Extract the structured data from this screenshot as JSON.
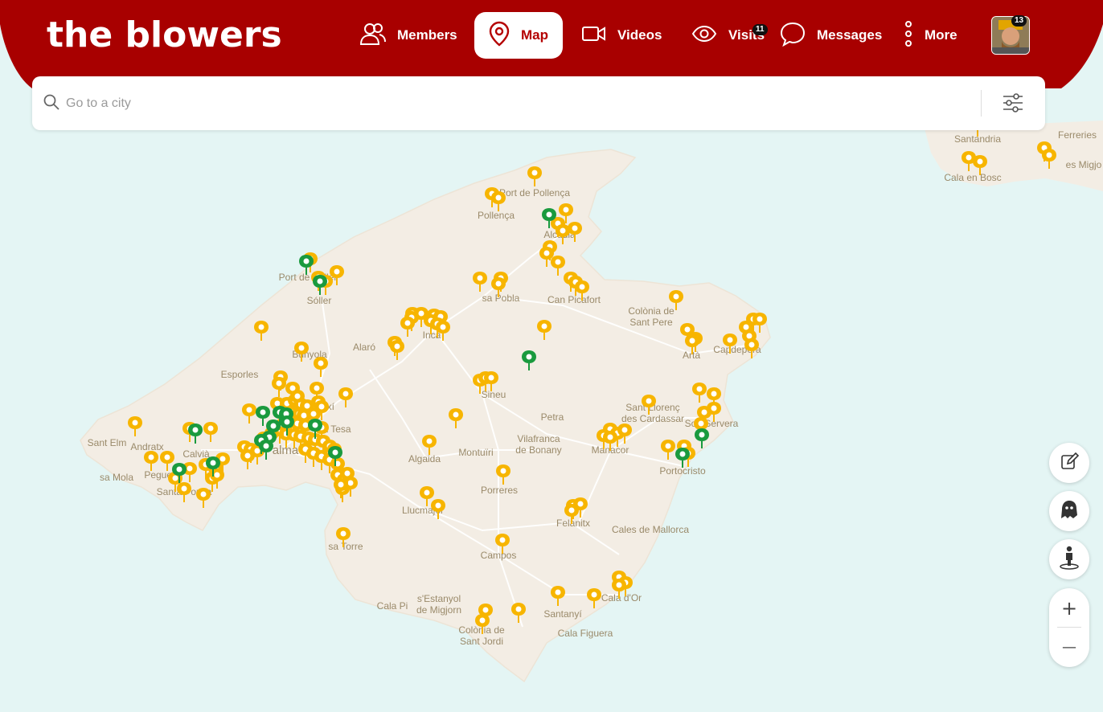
{
  "header": {
    "logo": "the blowers",
    "nav": [
      {
        "label": "Members",
        "icon": "members-icon"
      },
      {
        "label": "Map",
        "icon": "map-pin-icon",
        "active": true
      },
      {
        "label": "Videos",
        "icon": "video-camera-icon"
      },
      {
        "label": "Visits",
        "icon": "eye-icon",
        "badge": "11"
      },
      {
        "label": "Messages",
        "icon": "chat-bubble-icon"
      },
      {
        "label": "More",
        "icon": "more-vertical-icon"
      }
    ],
    "avatar_badge": "13"
  },
  "search": {
    "placeholder": "Go to a city",
    "value": ""
  },
  "map": {
    "region": "Mallorca",
    "colors": {
      "sea": "#e4f5f4",
      "land": "#f3ede4",
      "yellow_pin": "#f7b500",
      "green_pin": "#1a9a3e",
      "brand": "#b40000"
    },
    "places": [
      "Santandria",
      "Ferreries",
      "Cala en Bosc",
      "es Migjo",
      "Port de Pollença",
      "Pollença",
      "Alcúdia",
      "Port de Sóller",
      "Sóller",
      "sa Pobla",
      "Can Picafort",
      "Colònia de Sant Pere",
      "Inca",
      "Alaró",
      "Bunyola",
      "Artà",
      "Capdepera",
      "Esporles",
      "Marratxí",
      "Sineu",
      "Sant Llorenç des Cardassar",
      "Son Servera",
      "Sant Elm",
      "Andratx",
      "Calvià",
      "sa Tesa",
      "Petra",
      "Palma",
      "Montuïri",
      "Vilafranca de Bonany",
      "Manacor",
      "Portocristo",
      "sa Mola",
      "Peguera",
      "Santa Ponça",
      "Algaida",
      "Porreres",
      "Llucmajor",
      "Felanitx",
      "Cales de Mallorca",
      "sa Torre",
      "Campos",
      "Cala d'Or",
      "Cala Pi",
      "s'Estanyol de Migjorn",
      "Santanyí",
      "Colònia de Sant Jordi",
      "Cala Figuera"
    ],
    "pin_counts": {
      "yellow": 196,
      "green": 18
    }
  },
  "controls": {
    "edit": "edit-icon",
    "ghost": "ghost-icon",
    "person": "person-location-icon",
    "zoom_in": "+",
    "zoom_out": "—"
  }
}
